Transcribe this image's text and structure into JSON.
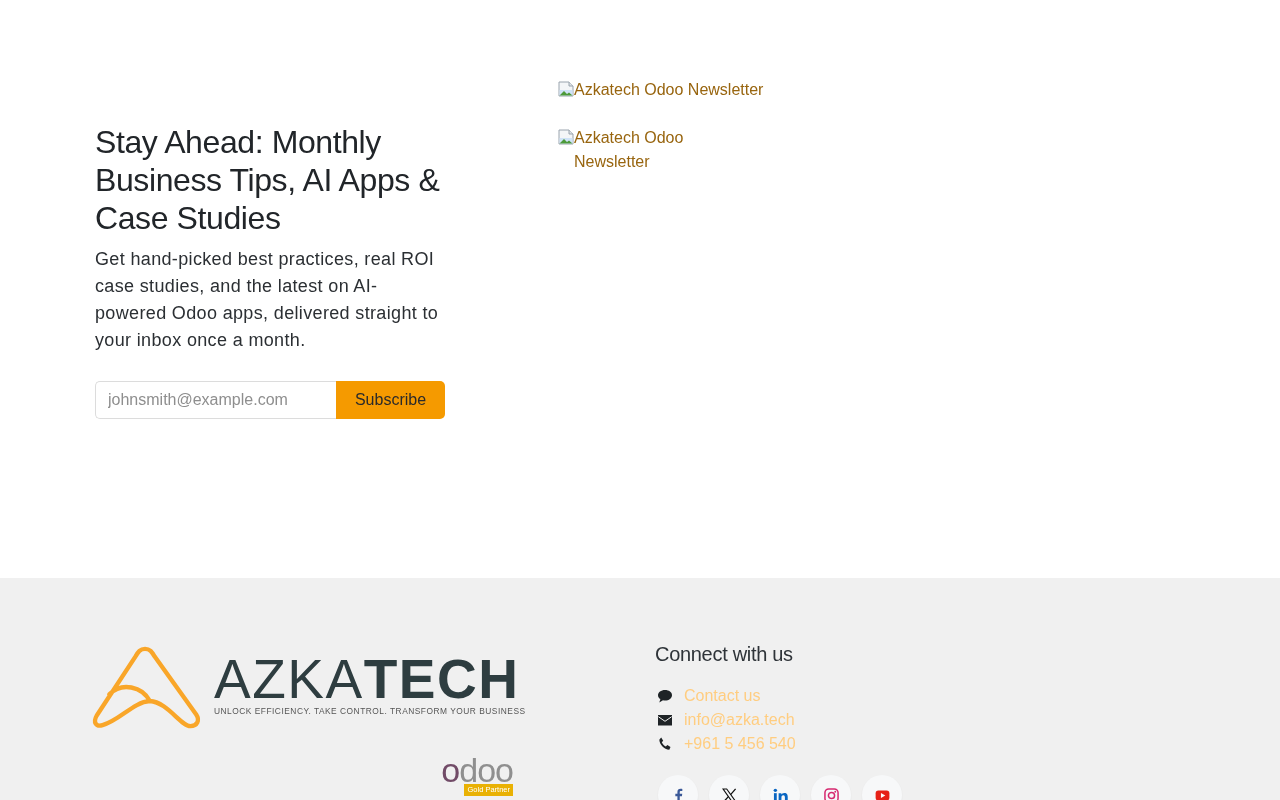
{
  "newsletter": {
    "heading": "Stay Ahead: Monthly Business Tips, AI Apps & Case Studies",
    "description": "Get hand-picked best practices, real ROI case studies, and the latest on AI-powered Odoo apps, delivered straight to your inbox once a month.",
    "email_field": {
      "placeholder": "johnsmith@example.com"
    },
    "subscribe_button": "Subscribe"
  },
  "images": [
    {
      "alt": "Azkatech Odoo Newsletter"
    },
    {
      "alt": "Azkatech Odoo Newsletter"
    }
  ],
  "footer": {
    "logo": {
      "wordmark": "AZKA**TECH**",
      "tagline": "UNLOCK EFFICIENCY. TAKE CONTROL. TRANSFORM YOUR BUSINESS"
    },
    "partner_badge": {
      "wordmark": "odoo",
      "label": "Gold Partner"
    },
    "connect": {
      "heading": "Connect with us",
      "contacts": [
        {
          "kind": "chat",
          "text": "Contact us"
        },
        {
          "kind": "email",
          "text": "info@azka.tech"
        },
        {
          "kind": "phone",
          "text": "+961 5 456 540"
        }
      ],
      "social": [
        {
          "kind": "facebook"
        },
        {
          "kind": "x"
        },
        {
          "kind": "linkedin"
        },
        {
          "kind": "instagram"
        },
        {
          "kind": "youtube"
        }
      ]
    }
  }
}
